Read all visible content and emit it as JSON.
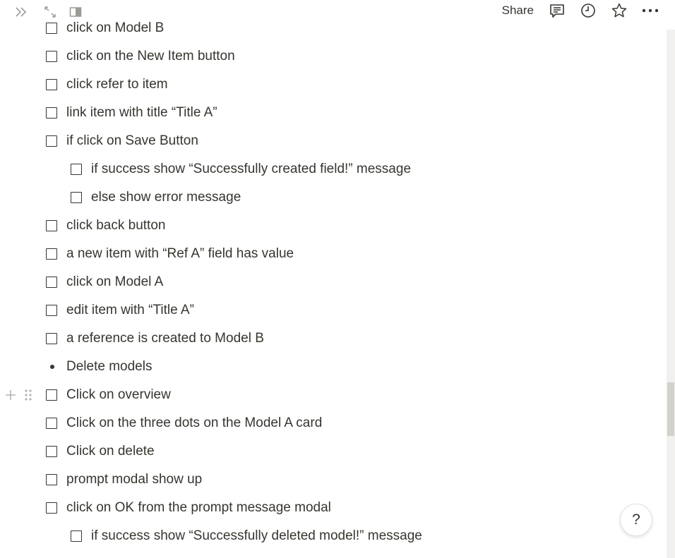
{
  "topbar": {
    "share_label": "Share",
    "icons": [
      "expand-sidebar-icon",
      "fullscreen-icon",
      "side-peek-icon",
      "comments-icon",
      "updates-clock-icon",
      "favorite-star-icon",
      "more-dots-icon"
    ]
  },
  "items": [
    {
      "type": "todo",
      "indent": 0,
      "text": "click on Model B"
    },
    {
      "type": "todo",
      "indent": 0,
      "text": "click on the New Item button"
    },
    {
      "type": "todo",
      "indent": 0,
      "text": "click refer to item"
    },
    {
      "type": "todo",
      "indent": 0,
      "text": "link item with title “Title A”"
    },
    {
      "type": "todo",
      "indent": 0,
      "text": "if click on Save Button"
    },
    {
      "type": "todo",
      "indent": 1,
      "text": "if success show “Successfully created field!” message"
    },
    {
      "type": "todo",
      "indent": 1,
      "text": "else show error message"
    },
    {
      "type": "todo",
      "indent": 0,
      "text": "click back button"
    },
    {
      "type": "todo",
      "indent": 0,
      "text": "a new item with “Ref A” field has value"
    },
    {
      "type": "todo",
      "indent": 0,
      "text": "click on Model A"
    },
    {
      "type": "todo",
      "indent": 0,
      "text": "edit item with “Title A”"
    },
    {
      "type": "todo",
      "indent": 0,
      "text": "a reference is created to Model B"
    },
    {
      "type": "bullet",
      "indent": 0,
      "text": "Delete models"
    },
    {
      "type": "todo",
      "indent": 0,
      "text": "Click on overview",
      "hover": true
    },
    {
      "type": "todo",
      "indent": 0,
      "text": "Click on the three dots on the Model A card"
    },
    {
      "type": "todo",
      "indent": 0,
      "text": "Click on delete"
    },
    {
      "type": "todo",
      "indent": 0,
      "text": "prompt modal show up"
    },
    {
      "type": "todo",
      "indent": 0,
      "text": "click on OK from the prompt message modal"
    },
    {
      "type": "todo",
      "indent": 1,
      "text": "if success show “Successfully deleted model!” message"
    },
    {
      "type": "todo",
      "indent": 1,
      "text": ""
    }
  ],
  "help_label": "?"
}
